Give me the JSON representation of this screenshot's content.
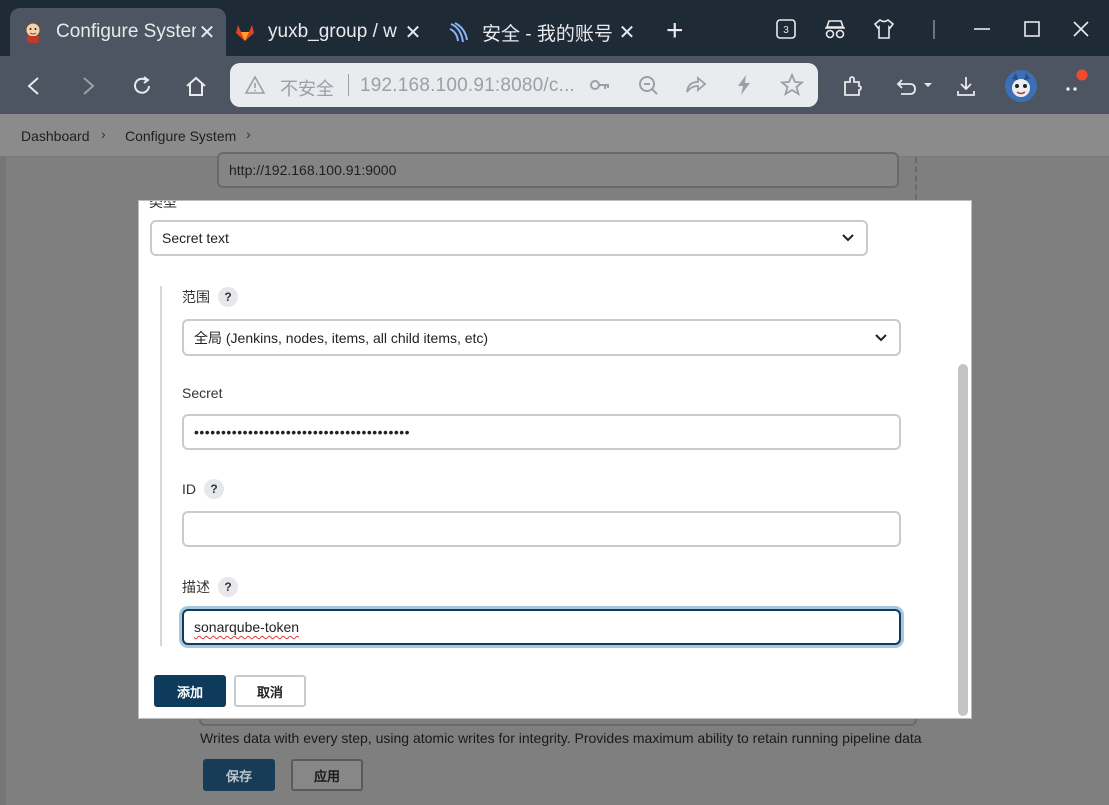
{
  "browser": {
    "tabs": [
      {
        "title": "Configure System",
        "active": true,
        "icon": "jenkins-icon"
      },
      {
        "title": "yuxb_group / w",
        "active": false,
        "icon": "gitlab-icon"
      },
      {
        "title": "安全 - 我的账号",
        "active": false,
        "icon": "security-site-icon"
      }
    ],
    "tab_count_badge": "3",
    "address": {
      "security_label": "不安全",
      "url": "192.168.100.91:8080/c..."
    }
  },
  "breadcrumb": {
    "items": [
      "Dashboard",
      "Configure System"
    ]
  },
  "background_page": {
    "server_url_value": "http://192.168.100.91:9000",
    "help_text": "Writes data with every step, using atomic writes for integrity.  Provides maximum ability to retain running pipeline data",
    "save_label": "保存",
    "apply_label": "应用"
  },
  "dialog": {
    "kind_label_partial": "类型",
    "kind_value": "Secret text",
    "scope_label": "范围",
    "scope_value": "全局 (Jenkins, nodes, items, all child items, etc)",
    "secret_label": "Secret",
    "secret_value": "••••••••••••••••••••••••••••••••••••••••",
    "id_label": "ID",
    "id_value": "",
    "description_label": "描述",
    "description_value": "sonarqube-token",
    "help_mark": "?",
    "add_label": "添加",
    "cancel_label": "取消"
  },
  "colors": {
    "primary_button": "#0e3b5b",
    "tab_bar": "#1f2a37",
    "toolbar": "#4c5561",
    "overlay": "#7f7f7f",
    "notification_dot": "#f04a2f"
  }
}
